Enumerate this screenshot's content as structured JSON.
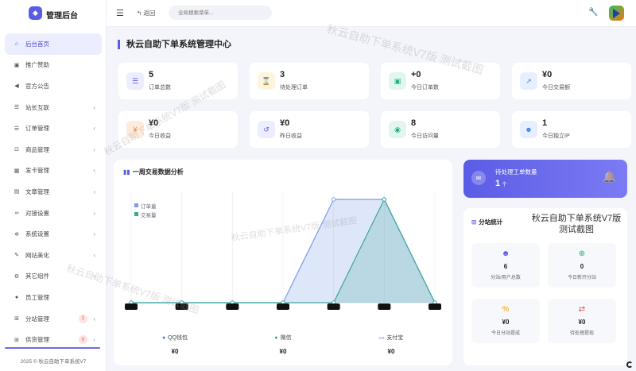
{
  "app": {
    "title": "管理后台",
    "footer": "2025 © 秋云自助下单系统V7"
  },
  "sidebar": {
    "items": [
      {
        "label": "后台首页",
        "icon": "home-icon",
        "glyph": "⌂",
        "active": true,
        "arrow": false
      },
      {
        "label": "推广赞助",
        "icon": "image-icon",
        "glyph": "▣",
        "arrow": false
      },
      {
        "label": "官方公告",
        "icon": "megaphone-icon",
        "glyph": "◀",
        "arrow": false
      },
      {
        "label": "站长互联",
        "icon": "list-icon",
        "glyph": "☰",
        "arrow": true
      },
      {
        "label": "订单管理",
        "icon": "list-icon",
        "glyph": "☰",
        "arrow": true
      },
      {
        "label": "商品管理",
        "icon": "cart-icon",
        "glyph": "⊡",
        "arrow": true
      },
      {
        "label": "发卡管理",
        "icon": "grid-icon",
        "glyph": "▦",
        "arrow": true
      },
      {
        "label": "文章管理",
        "icon": "book-icon",
        "glyph": "▤",
        "arrow": true
      },
      {
        "label": "对接设置",
        "icon": "link-icon",
        "glyph": "∞",
        "arrow": true
      },
      {
        "label": "系统设置",
        "icon": "gear-icon",
        "glyph": "✲",
        "arrow": true
      },
      {
        "label": "网站美化",
        "icon": "brush-icon",
        "glyph": "✎",
        "arrow": true
      },
      {
        "label": "其它组件",
        "icon": "cogs-icon",
        "glyph": "⚙",
        "arrow": true
      },
      {
        "label": "员工管理",
        "icon": "user-icon",
        "glyph": "●",
        "arrow": false
      },
      {
        "label": "分站管理",
        "icon": "sitemap-icon",
        "glyph": "⊞",
        "arrow": true,
        "badge": "1"
      },
      {
        "label": "供货管理",
        "icon": "sitemap-icon",
        "glyph": "⊞",
        "arrow": true,
        "badge": "0"
      }
    ]
  },
  "topbar": {
    "back": "返回",
    "search_placeholder": "全局搜索菜单..."
  },
  "main": {
    "title": "秋云自助下单系统管理中心",
    "stats": [
      {
        "value": "5",
        "label": "订单总数",
        "icon": "list-icon",
        "glyph": "☰",
        "color": "#5b5ce6",
        "bg": "#ecedff"
      },
      {
        "value": "3",
        "label": "待处理订单",
        "icon": "hourglass-icon",
        "glyph": "⌛",
        "color": "#d9a11f",
        "bg": "#fdf4dc"
      },
      {
        "value": "+0",
        "label": "今日订单数",
        "icon": "calendar-check-icon",
        "glyph": "▣",
        "color": "#22b07d",
        "bg": "#e1f7ee"
      },
      {
        "value": "¥0",
        "label": "今日交易额",
        "icon": "chart-line-icon",
        "glyph": "↗",
        "color": "#3b82f6",
        "bg": "#e6efff"
      },
      {
        "value": "¥0",
        "label": "今日收益",
        "icon": "money-icon",
        "glyph": "¥",
        "color": "#e8873a",
        "bg": "#fdebdc"
      },
      {
        "value": "¥0",
        "label": "昨日收益",
        "icon": "history-icon",
        "glyph": "↺",
        "color": "#5b5ce6",
        "bg": "#ecedff"
      },
      {
        "value": "8",
        "label": "今日访问量",
        "icon": "eye-icon",
        "glyph": "◉",
        "color": "#22b07d",
        "bg": "#e1f7ee"
      },
      {
        "value": "1",
        "label": "今日独立IP",
        "icon": "users-icon",
        "glyph": "☻",
        "color": "#3b82f6",
        "bg": "#e6efff"
      }
    ]
  },
  "chart": {
    "title": "一周交易数据分析",
    "payments": [
      {
        "name": "QQ钱包",
        "value": "¥0",
        "icon": "qq-icon",
        "glyph": "●",
        "color": "#3b82f6"
      },
      {
        "name": "微信",
        "value": "¥0",
        "icon": "wechat-icon",
        "glyph": "●",
        "color": "#22b07d"
      },
      {
        "name": "支付宝",
        "value": "¥0",
        "icon": "alipay-icon",
        "glyph": "▭",
        "color": "#3b82f6"
      }
    ]
  },
  "chart_data": {
    "type": "area",
    "categories": [
      "",
      "",
      "",
      "",
      "",
      "",
      ""
    ],
    "series": [
      {
        "name": "订单量",
        "values": [
          0,
          0,
          0,
          0,
          2,
          2,
          0
        ],
        "color": "#7b9be8"
      },
      {
        "name": "交易量",
        "values": [
          0,
          0,
          0,
          0,
          0,
          2,
          0
        ],
        "color": "#3aa89a"
      }
    ],
    "ylim": [
      0,
      2
    ],
    "grid": true,
    "legend": "top-left"
  },
  "ticket": {
    "title": "待处理工单数量",
    "value": "1",
    "unit": "个"
  },
  "substation": {
    "title": "分站统计",
    "tiles": [
      {
        "value": "6",
        "label": "分站/用户总数",
        "icon": "users-icon",
        "glyph": "☻",
        "color": "#5b5ce6"
      },
      {
        "value": "0",
        "label": "今日新开分站",
        "icon": "plus-circle-icon",
        "glyph": "⊕",
        "color": "#22b07d"
      },
      {
        "value": "¥0",
        "label": "今日分站提成",
        "icon": "percent-icon",
        "glyph": "%",
        "color": "#e8a21f"
      },
      {
        "value": "¥0",
        "label": "待处理提现",
        "icon": "exchange-icon",
        "glyph": "⇄",
        "color": "#e25555"
      }
    ]
  },
  "watermark": {
    "text": "秋云自助下单系统V7版 测试截图",
    "line1": "秋云自助下单系统V7版",
    "line2": "测试截图"
  }
}
